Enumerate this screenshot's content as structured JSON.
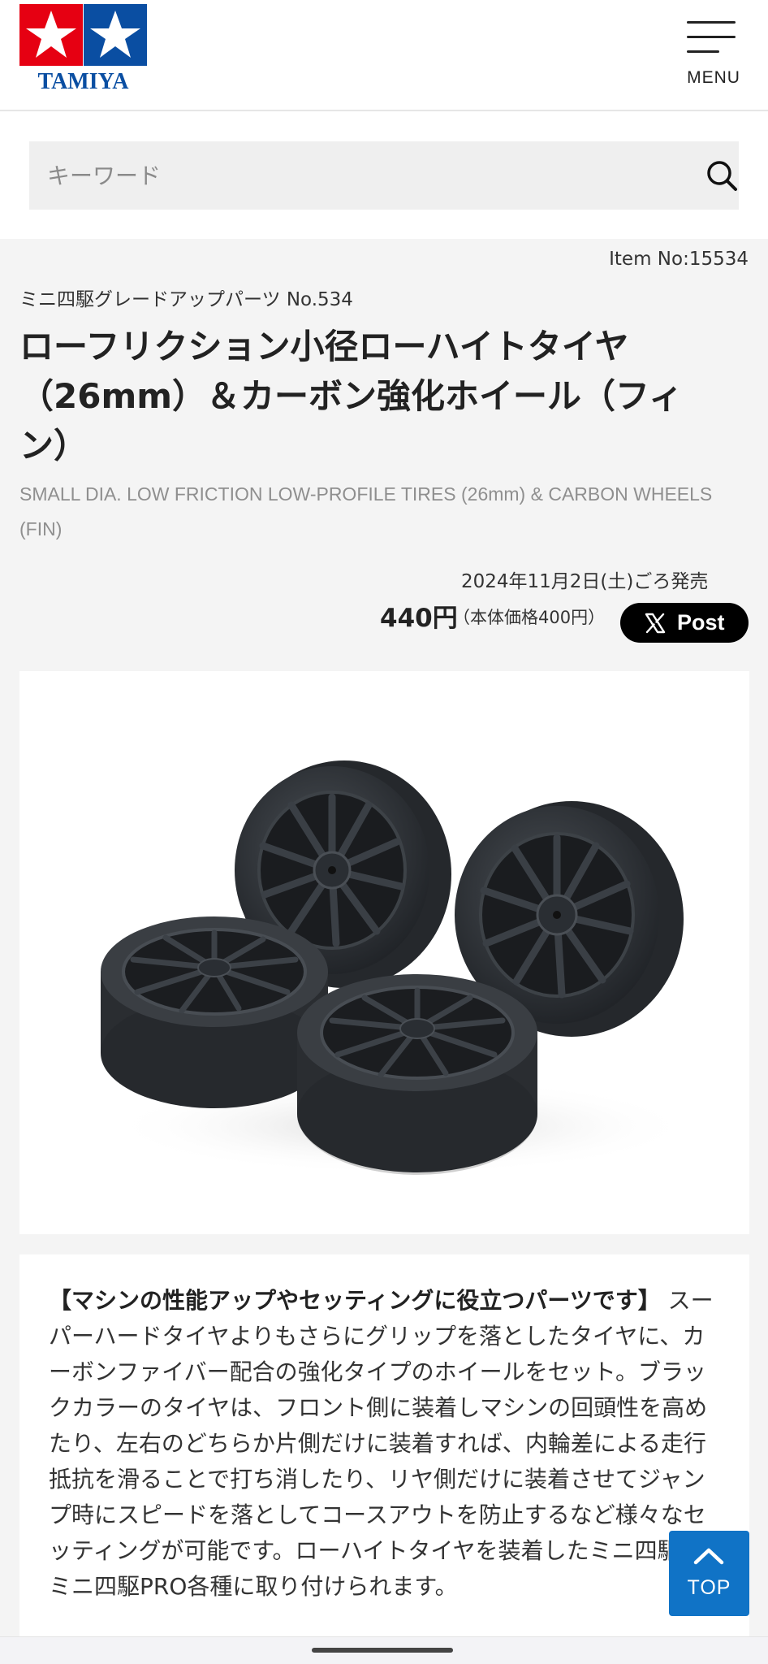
{
  "header": {
    "logo_text": "TAMIYA",
    "menu_label": "MENU",
    "colors": {
      "logo_red": "#e60012",
      "logo_blue": "#0a4ea2"
    }
  },
  "search": {
    "placeholder": "キーワード",
    "icon": "search-icon"
  },
  "product": {
    "item_no": "Item No:15534",
    "series": "ミニ四駆グレードアップパーツ No.534",
    "title_lines": [
      "ローフリクション小径ローハイトタイヤ",
      "（26mm）＆カーボン強化ホイール（フィ",
      "ン）"
    ],
    "subtitle": "SMALL DIA. LOW FRICTION LOW-PROFILE TIRES (26mm) & CARBON WHEELS (FIN)",
    "release": "2024年11月2日(土)ごろ発売",
    "price": "440円",
    "price_note": "（本体価格400円）",
    "share_label": "Post"
  },
  "description": {
    "heading": "【マシンの性能アップやセッティングに役立つパーツです】",
    "body": "スーパーハードタイヤよりもさらにグリップを落としたタイヤに、カーボンファイバー配合の強化タイプのホイールをセット。ブラックカラーのタイヤは、フロント側に装着しマシンの回頭性を高めたり、左右のどちらか片側だけに装着すれば、内輪差による走行抵抗を滑ることで打ち消したり、リヤ側だけに装着させてジャンプ時にスピードを落としてコースアウトを防止するなど様々なセッティングが可能です。ローハイトタイヤを装着したミニ四駆、ミニ四駆PRO各種に取り付けられます。"
  },
  "top_button": {
    "label": "TOP",
    "color": "#1073c6"
  }
}
